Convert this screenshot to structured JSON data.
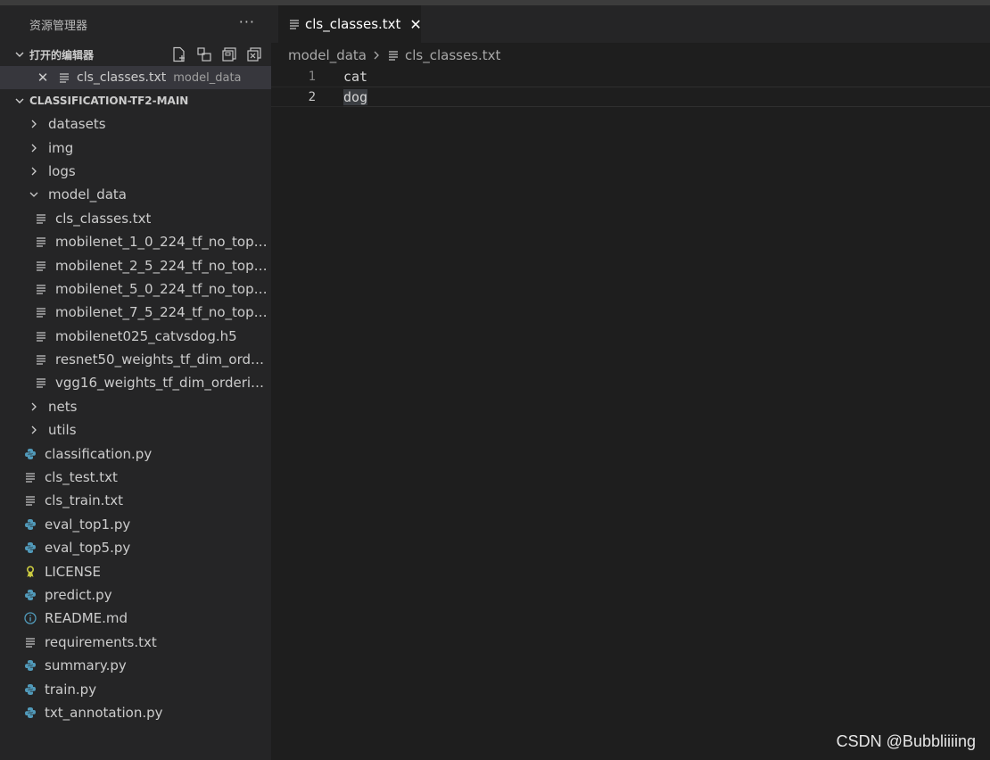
{
  "sidebar": {
    "title": "资源管理器",
    "more": "···",
    "open_editors": {
      "header": "打开的编辑器",
      "item": {
        "name": "cls_classes.txt",
        "description": "model_data"
      }
    },
    "project": {
      "header": "CLASSIFICATION-TF2-MAIN",
      "folders_top": [
        {
          "label": "datasets"
        },
        {
          "label": "img"
        },
        {
          "label": "logs"
        }
      ],
      "model_data": {
        "label": "model_data",
        "files": [
          {
            "label": "cls_classes.txt"
          },
          {
            "label": "mobilenet_1_0_224_tf_no_top.h5"
          },
          {
            "label": "mobilenet_2_5_224_tf_no_top.h5"
          },
          {
            "label": "mobilenet_5_0_224_tf_no_top.h5"
          },
          {
            "label": "mobilenet_7_5_224_tf_no_top.h5"
          },
          {
            "label": "mobilenet025_catvsdog.h5"
          },
          {
            "label": "resnet50_weights_tf_dim_orderin..."
          },
          {
            "label": "vgg16_weights_tf_dim_ordering_t..."
          }
        ]
      },
      "folders_bottom": [
        {
          "label": "nets"
        },
        {
          "label": "utils"
        }
      ],
      "files": [
        {
          "label": "classification.py",
          "icon": "python-icon"
        },
        {
          "label": "cls_test.txt",
          "icon": "text-file-icon"
        },
        {
          "label": "cls_train.txt",
          "icon": "text-file-icon"
        },
        {
          "label": "eval_top1.py",
          "icon": "python-icon"
        },
        {
          "label": "eval_top5.py",
          "icon": "python-icon"
        },
        {
          "label": "LICENSE",
          "icon": "license-icon"
        },
        {
          "label": "predict.py",
          "icon": "python-icon"
        },
        {
          "label": "README.md",
          "icon": "info-icon"
        },
        {
          "label": "requirements.txt",
          "icon": "text-file-icon"
        },
        {
          "label": "summary.py",
          "icon": "python-icon"
        },
        {
          "label": "train.py",
          "icon": "python-icon"
        },
        {
          "label": "txt_annotation.py",
          "icon": "python-icon"
        }
      ]
    }
  },
  "editor": {
    "tab": {
      "label": "cls_classes.txt"
    },
    "breadcrumb": {
      "folder": "model_data",
      "file": "cls_classes.txt"
    },
    "lines": [
      {
        "number": "1",
        "text": "cat"
      },
      {
        "number": "2",
        "text": "dog"
      }
    ]
  },
  "watermark": "CSDN @Bubbliiiing",
  "colors": {
    "sidebar_bg": "#252526",
    "editor_bg": "#1e1e1e",
    "python_icon": "#519aba",
    "license_icon": "#cbcb41",
    "info_icon": "#519aba"
  }
}
